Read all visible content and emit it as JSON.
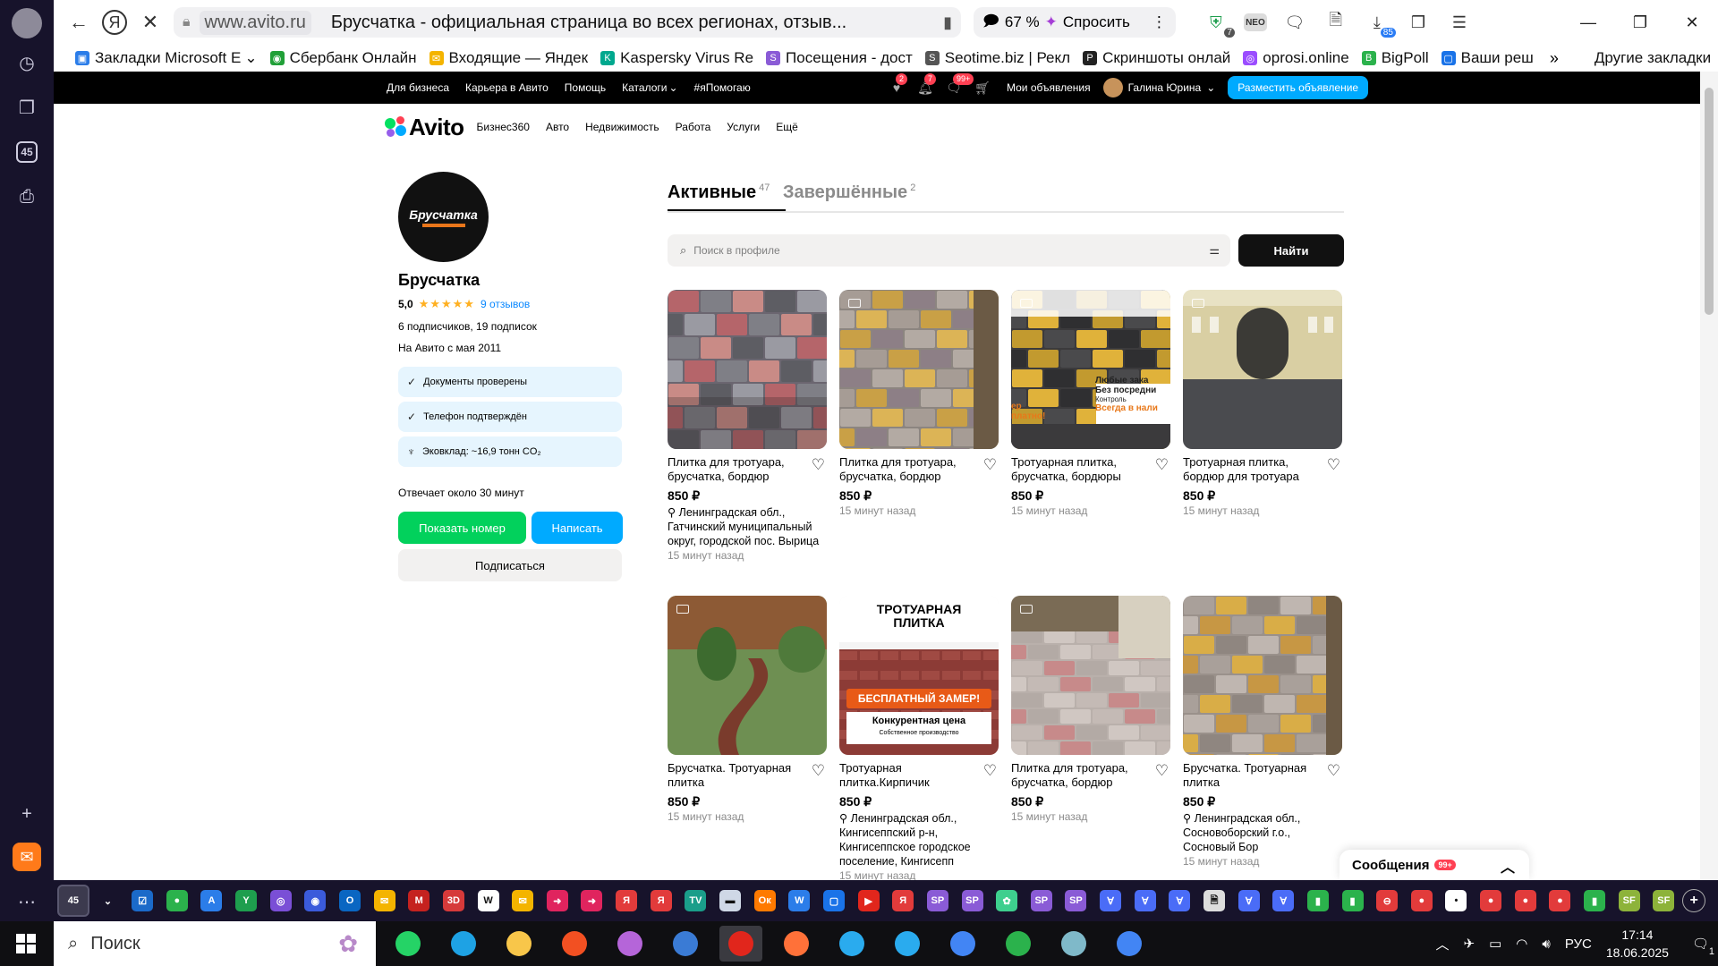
{
  "browser": {
    "host": "www.avito.ru",
    "tab_title": "Брусчатка - официальная страница во всех регионах, отзыв...",
    "zoom": "67 %",
    "ask_label": "Спросить",
    "ext_badge_1": "7",
    "ext_badge_2": "85",
    "ext_neo": "NEO",
    "rail_badge": "45"
  },
  "bookmarks": [
    {
      "label": "Закладки Microsoft E",
      "color": "#2b7de9",
      "glyph": "▣"
    },
    {
      "label": "Сбербанк Онлайн",
      "color": "#21a038",
      "glyph": "◉"
    },
    {
      "label": "Входящие — Яндек",
      "color": "#f4b400",
      "glyph": "✉"
    },
    {
      "label": "Kaspersky Virus Re",
      "color": "#00a88e",
      "glyph": "K"
    },
    {
      "label": "Посещения - дост",
      "color": "#8a5bd6",
      "glyph": "S"
    },
    {
      "label": "Seotime.biz | Рекл",
      "color": "#555555",
      "glyph": "S"
    },
    {
      "label": "Скриншоты онлай",
      "color": "#222222",
      "glyph": "P"
    },
    {
      "label": "oprosi.online",
      "color": "#9b4dff",
      "glyph": "◎"
    },
    {
      "label": "BigPoll",
      "color": "#2bb24c",
      "glyph": "B"
    },
    {
      "label": "Ваши реш",
      "color": "#1a73e8",
      "glyph": "▢"
    }
  ],
  "bookmarks_more": "»",
  "bookmarks_other": "Другие закладки",
  "avito_top": {
    "links": [
      "Для бизнеса",
      "Карьера в Авито",
      "Помощь",
      "Каталоги",
      "#яПомогаю"
    ],
    "badge_fav": "2",
    "badge_notif": "7",
    "badge_msg": "99+",
    "my_ads": "Мои объявления",
    "user": "Галина Юрина",
    "post_button": "Разместить объявление"
  },
  "avito_nav": {
    "logo": "Avito",
    "links": [
      "Бизнес360",
      "Авто",
      "Недвижимость",
      "Работа",
      "Услуги",
      "Ещё"
    ]
  },
  "profile": {
    "logo_text": "Брусчатка",
    "name": "Брусчатка",
    "rating": "5,0",
    "stars": "★★★★★",
    "reviews": "9 отзывов",
    "subs": "6 подписчиков, 19 подписок",
    "since": "На Авито с мая 2011",
    "chips": [
      {
        "icon": "✓",
        "text": "Документы проверены"
      },
      {
        "icon": "✓",
        "text": "Телефон подтверждён"
      },
      {
        "icon": "♆",
        "text": "Эковклад: ~16,9 тонн CO₂"
      }
    ],
    "response": "Отвечает около 30 минут",
    "show_phone": "Показать номер",
    "write": "Написать",
    "subscribe": "Подписаться"
  },
  "tabs": {
    "active": "Активные",
    "active_count": "47",
    "done": "Завершённые",
    "done_count": "2"
  },
  "search": {
    "placeholder": "Поиск в профиле",
    "button": "Найти"
  },
  "listings": [
    {
      "title": "Плитка для тротуара, брусчатка, бордюр",
      "price": "850 ₽",
      "location": "Ленинградская обл., Гатчинский муниципальный округ, городской пос. Вырица",
      "time": "15 минут назад"
    },
    {
      "title": "Плитка для тротуара, брусчатка, бордюр",
      "price": "850 ₽",
      "location": "",
      "time": "15 минут назад"
    },
    {
      "title": "Тротуарная плитка, брусчатка, бордюры",
      "price": "850 ₽",
      "location": "",
      "time": "15 минут назад",
      "img_text": [
        "Любые зака",
        "Без посредни",
        "Контроль",
        "Всегда в нали",
        "ер",
        "платно!"
      ]
    },
    {
      "title": "Тротуарная плитка, бордюр для тротуара",
      "price": "850 ₽",
      "location": "",
      "time": "15 минут назад"
    },
    {
      "title": "Брусчатка. Тротуарная плитка",
      "price": "850 ₽",
      "location": "",
      "time": "15 минут назад"
    },
    {
      "title": "Тротуарная плитка.Кирпичик",
      "price": "850 ₽",
      "location": "Ленинградская обл., Кингисеппский р-н, Кингисеппское городское поселение, Кингисепп",
      "time": "15 минут назад",
      "img_text": [
        "ТРОТУАРНАЯ",
        "ПЛИТКА",
        "БЕСПЛАТНЫЙ ЗАМЕР!",
        "Конкурентная цена",
        "Собственное производство"
      ]
    },
    {
      "title": "Плитка для тротуара, брусчатка, бордюр",
      "price": "850 ₽",
      "location": "",
      "time": "15 минут назад"
    },
    {
      "title": "Брусчатка. Тротуарная плитка",
      "price": "850 ₽",
      "location": "Ленинградская обл., Сосновоборский г.о., Сосновый Бор",
      "time": "15 минут назад"
    }
  ],
  "messages_widget": {
    "label": "Сообщения",
    "count": "99+"
  },
  "taskbar": {
    "search": "Поиск",
    "lang": "РУС",
    "time": "17:14",
    "date": "18.06.2025",
    "notif": "1"
  }
}
